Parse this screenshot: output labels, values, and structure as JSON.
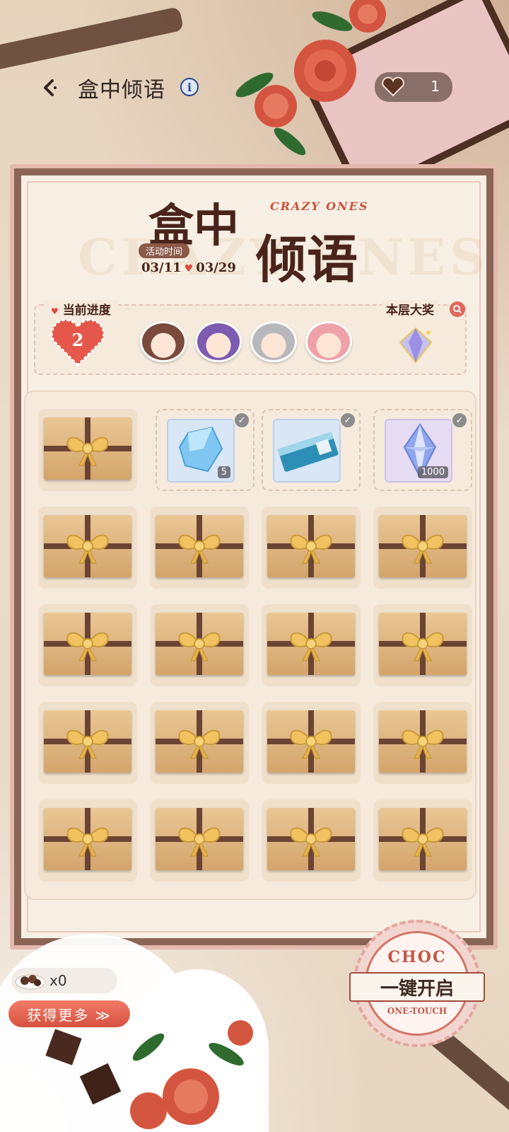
{
  "header": {
    "title": "盒中倾语",
    "info_symbol": "i",
    "chocolate_count": "1"
  },
  "event": {
    "title_line1": "盒中",
    "title_line2": "倾语",
    "subtitle": "CRAZY ONES",
    "watermark": "CRAZY ONES",
    "time_label": "活动时间",
    "start_date": "03/11",
    "end_date": "03/29",
    "date_separator": "♥"
  },
  "progress": {
    "label": "当前进度",
    "value": "2",
    "characters": [
      {
        "name": "avatar-1",
        "color": "#7a4a3a"
      },
      {
        "name": "avatar-2",
        "color": "#7c5bb0"
      },
      {
        "name": "avatar-3",
        "color": "#b8b8bc"
      },
      {
        "name": "avatar-4",
        "color": "#f0a0a8"
      }
    ],
    "grand_prize_label": "本层大奖"
  },
  "grid": {
    "rows": [
      [
        {
          "state": "gift"
        },
        {
          "state": "revealed",
          "reward": "crystal",
          "qty": "5",
          "color": "#d8e6f6"
        },
        {
          "state": "revealed",
          "reward": "ticket",
          "qty": "",
          "color": "#d8e6f6"
        },
        {
          "state": "revealed",
          "reward": "star-crystal",
          "qty": "1000",
          "color": "#e5dbf3"
        }
      ],
      [
        {
          "state": "gift"
        },
        {
          "state": "gift"
        },
        {
          "state": "gift"
        },
        {
          "state": "gift"
        }
      ],
      [
        {
          "state": "gift"
        },
        {
          "state": "gift"
        },
        {
          "state": "gift"
        },
        {
          "state": "gift"
        }
      ],
      [
        {
          "state": "gift"
        },
        {
          "state": "gift"
        },
        {
          "state": "gift"
        },
        {
          "state": "gift"
        }
      ],
      [
        {
          "state": "gift"
        },
        {
          "state": "gift"
        },
        {
          "state": "gift"
        },
        {
          "state": "gift"
        }
      ]
    ]
  },
  "bottom": {
    "chocolate_count": "x0",
    "get_more_label": "获得更多 ≫",
    "one_touch_top": "CHOC",
    "one_touch_label": "一键开启",
    "one_touch_bottom": "ONE-TOUCH"
  },
  "colors": {
    "accent_red": "#d94a3f",
    "brown": "#4a241b",
    "panel_bg": "#f7efe3"
  }
}
